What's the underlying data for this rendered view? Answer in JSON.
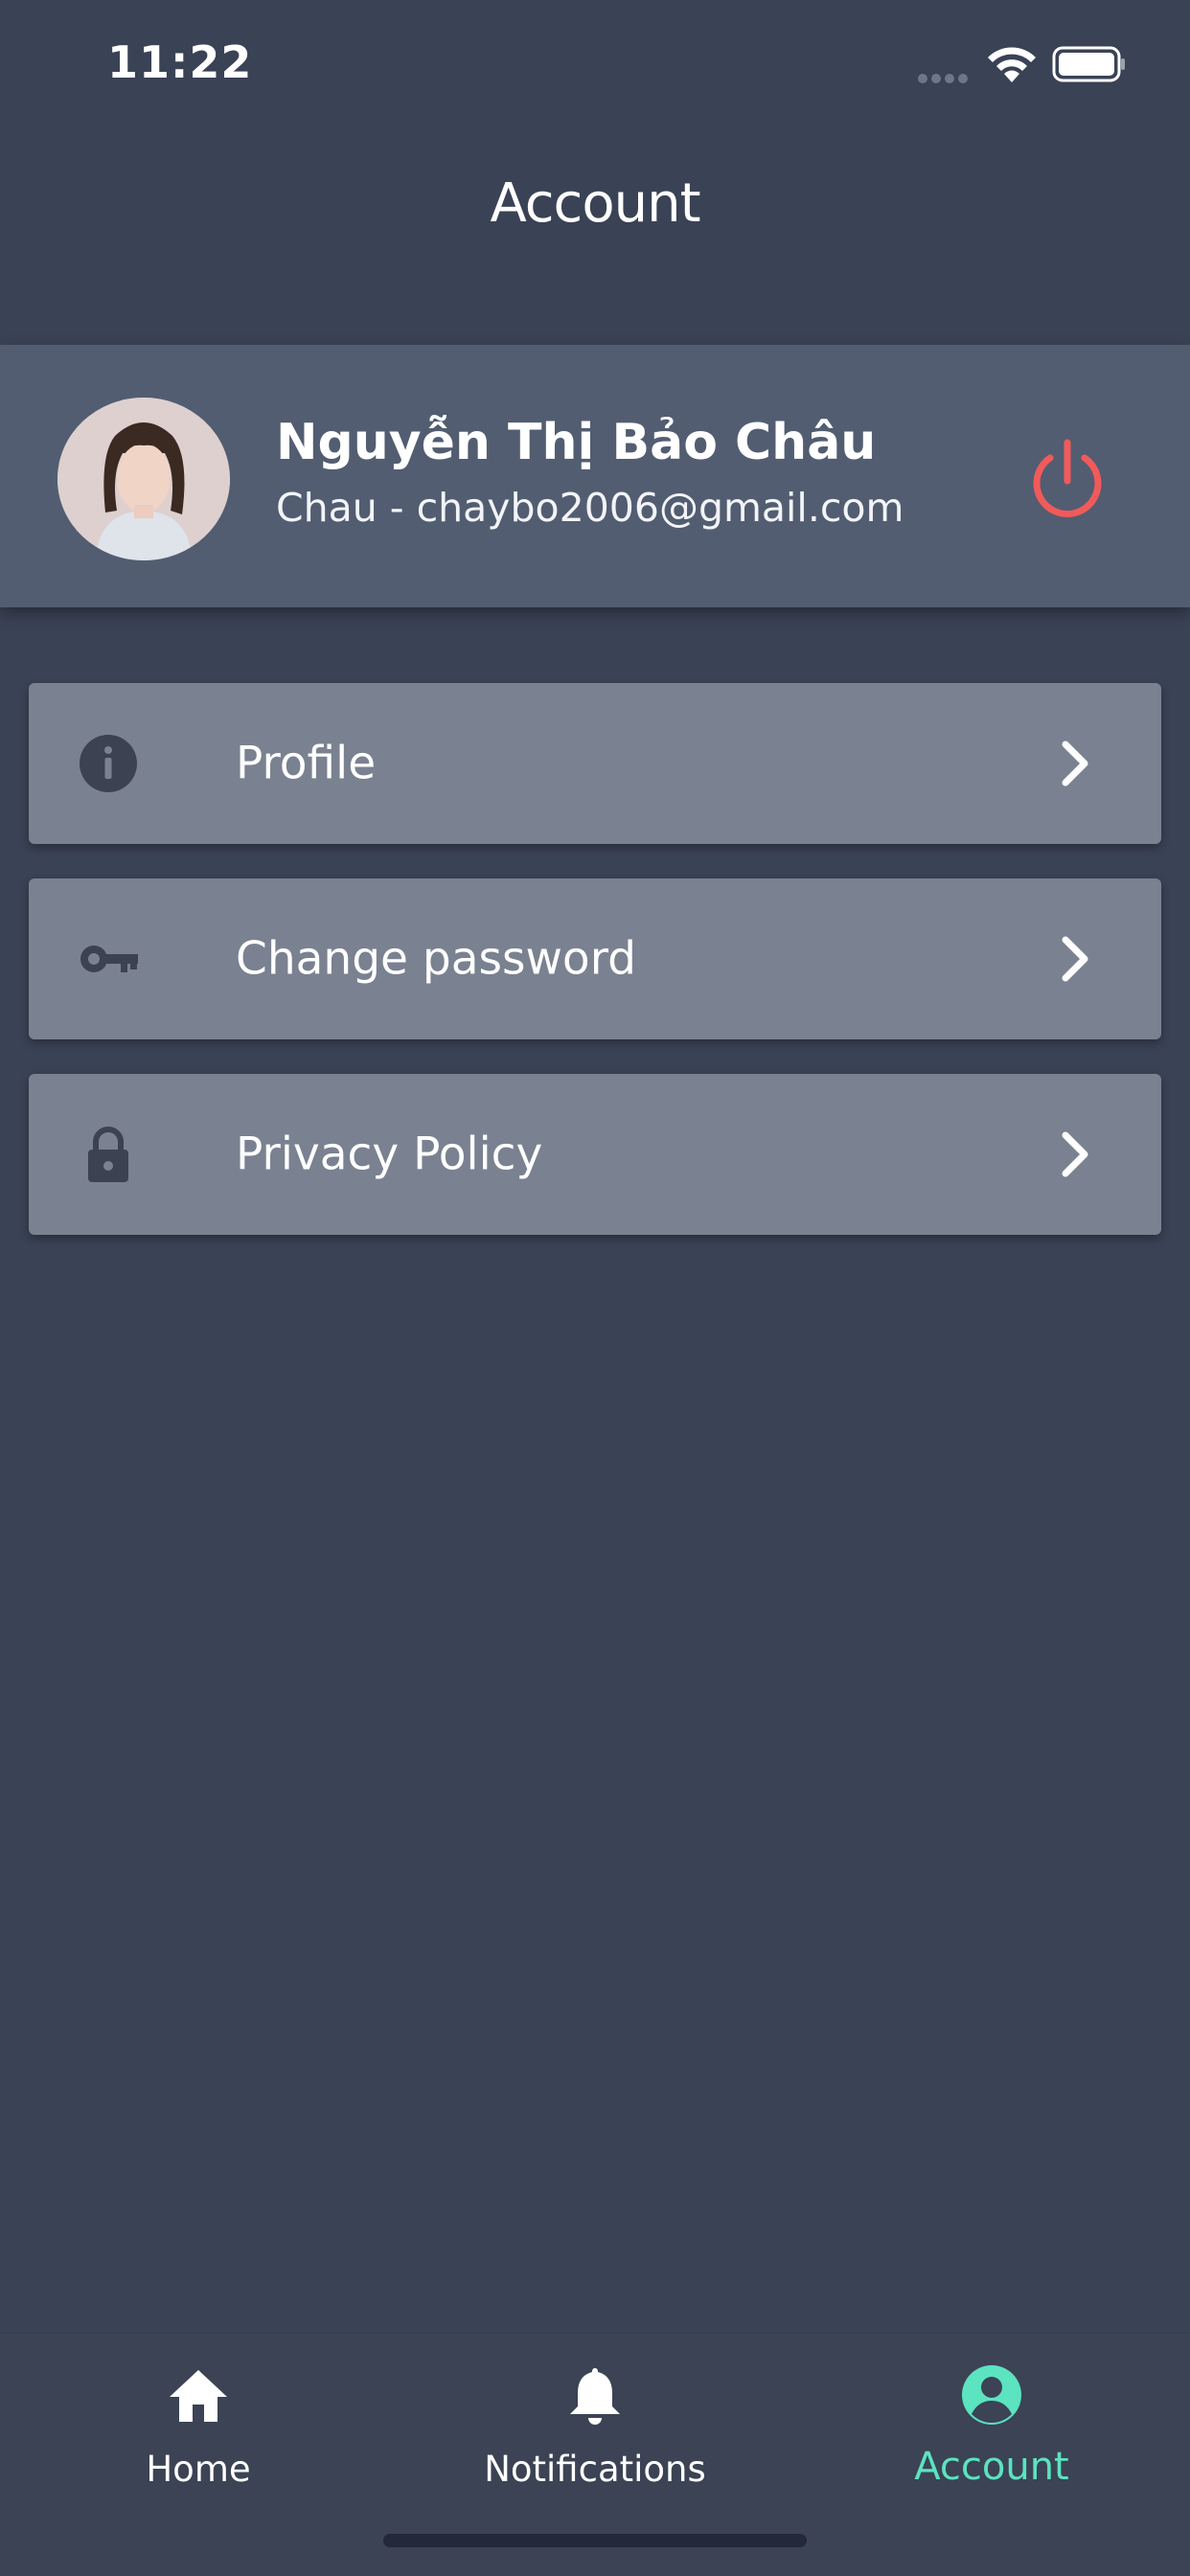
{
  "status_bar": {
    "time": "11:22"
  },
  "header": {
    "title": "Account"
  },
  "user": {
    "name": "Nguyễn Thị Bảo Châu",
    "subtitle": "Chau - chaybo2006@gmail.com"
  },
  "menu": [
    {
      "label": "Profile",
      "icon": "info-icon"
    },
    {
      "label": "Change password",
      "icon": "key-icon"
    },
    {
      "label": "Privacy Policy",
      "icon": "lock-icon"
    }
  ],
  "tabs": [
    {
      "label": "Home",
      "icon": "home-icon",
      "active": false
    },
    {
      "label": "Notifications",
      "icon": "bell-icon",
      "active": false
    },
    {
      "label": "Account",
      "icon": "account-icon",
      "active": true
    }
  ],
  "colors": {
    "background": "#3a4255",
    "card": "#525d71",
    "menu_item": "#7a8190",
    "accent": "#5ce3c0",
    "logout": "#f15a5a"
  }
}
